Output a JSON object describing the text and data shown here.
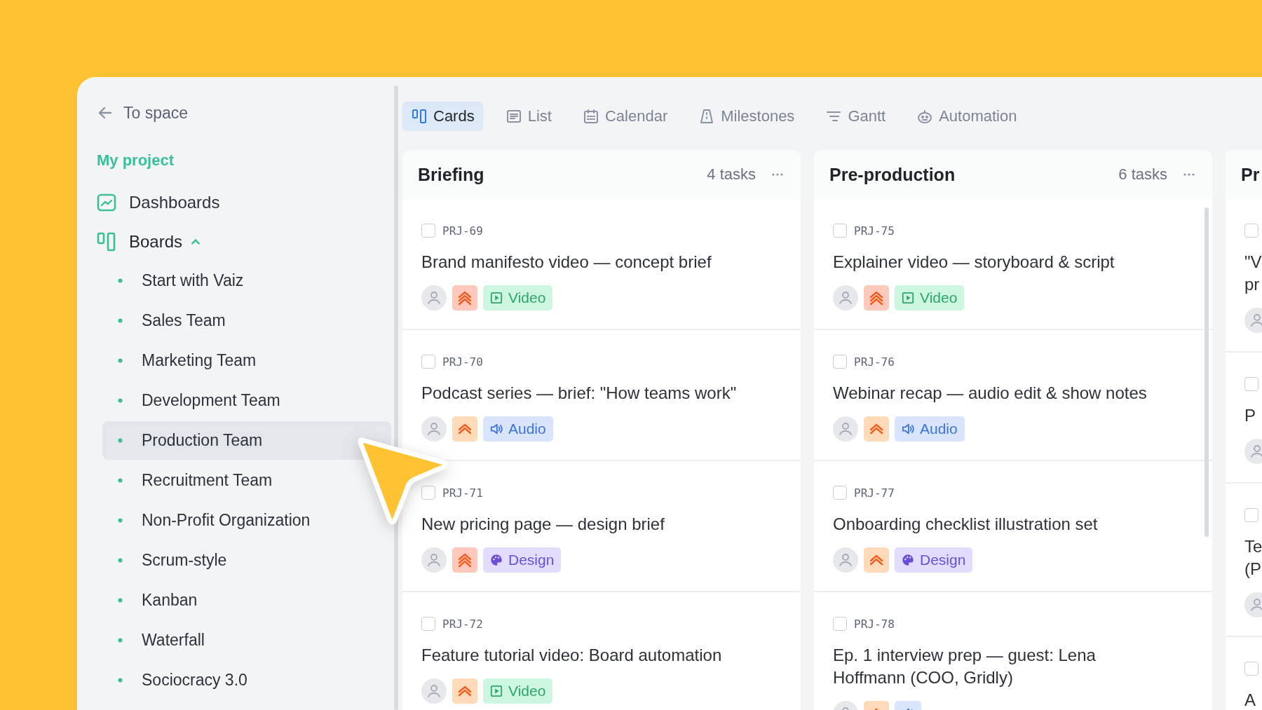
{
  "sidebar": {
    "back_link": "To space",
    "project": "My project",
    "nav": [
      {
        "label": "Dashboards",
        "kind": "dashboards"
      },
      {
        "label": "Boards",
        "kind": "boards",
        "expanded": true,
        "children": [
          {
            "label": "Start with Vaiz",
            "selected": false
          },
          {
            "label": "Sales Team",
            "selected": false
          },
          {
            "label": "Marketing Team",
            "selected": false
          },
          {
            "label": "Development Team",
            "selected": false
          },
          {
            "label": "Production Team",
            "selected": true
          },
          {
            "label": "Recruitment Team",
            "selected": false
          },
          {
            "label": "Non-Profit Organization",
            "selected": false
          },
          {
            "label": "Scrum-style",
            "selected": false
          },
          {
            "label": "Kanban",
            "selected": false
          },
          {
            "label": "Waterfall",
            "selected": false
          },
          {
            "label": "Sociocracy 3.0",
            "selected": false
          }
        ]
      }
    ]
  },
  "tabs": [
    {
      "label": "Cards",
      "kind": "cards",
      "selected": true
    },
    {
      "label": "List",
      "kind": "list",
      "selected": false
    },
    {
      "label": "Calendar",
      "kind": "calendar",
      "selected": false
    },
    {
      "label": "Milestones",
      "kind": "milestones",
      "selected": false
    },
    {
      "label": "Gantt",
      "kind": "gantt",
      "selected": false
    },
    {
      "label": "Automation",
      "kind": "automation",
      "selected": false
    }
  ],
  "board": {
    "columns": [
      {
        "title": "Briefing",
        "count": "4 tasks",
        "cards": [
          {
            "id": "PRJ-69",
            "checked": false,
            "title": "Brand manifesto video — concept brief",
            "urgent": true,
            "tag": {
              "kind": "video",
              "label": "Video"
            }
          },
          {
            "id": "PRJ-70",
            "checked": false,
            "title": "Podcast series — brief: \"How teams work\"",
            "urgent": false,
            "tag": {
              "kind": "audio",
              "label": "Audio"
            }
          },
          {
            "id": "PRJ-71",
            "checked": false,
            "title": "New pricing page — design brief",
            "urgent": true,
            "tag": {
              "kind": "design",
              "label": "Design"
            }
          },
          {
            "id": "PRJ-72",
            "checked": false,
            "title": "Feature tutorial video: Board automation",
            "urgent": false,
            "tag": {
              "kind": "video",
              "label": "Video"
            }
          }
        ]
      },
      {
        "title": "Pre-production",
        "count": "6 tasks",
        "cards": [
          {
            "id": "PRJ-75",
            "checked": false,
            "title": "Explainer video — storyboard & script",
            "urgent": true,
            "tag": {
              "kind": "video",
              "label": "Video"
            }
          },
          {
            "id": "PRJ-76",
            "checked": false,
            "title": "Webinar recap — audio edit & show notes",
            "urgent": false,
            "tag": {
              "kind": "audio",
              "label": "Audio"
            }
          },
          {
            "id": "PRJ-77",
            "checked": false,
            "title": "Onboarding checklist illustration set",
            "urgent": false,
            "tag": {
              "kind": "design",
              "label": "Design"
            }
          },
          {
            "id": "PRJ-78",
            "checked": false,
            "title": "Ep. 1 interview prep — guest: Lena Hoffmann (COO, Gridly)",
            "urgent": false,
            "tag": {
              "kind": "audio"
            }
          }
        ]
      }
    ],
    "partial_column": {
      "title": "Pr",
      "cards": [
        {
          "checked": false,
          "title_lines": [
            "\"V",
            "pr"
          ]
        },
        {
          "checked": false,
          "title_lines": [
            "P"
          ]
        },
        {
          "checked": false,
          "title_lines": [
            "Te",
            "(P"
          ]
        },
        {
          "checked": false,
          "title_lines": [
            "A"
          ]
        }
      ]
    }
  }
}
